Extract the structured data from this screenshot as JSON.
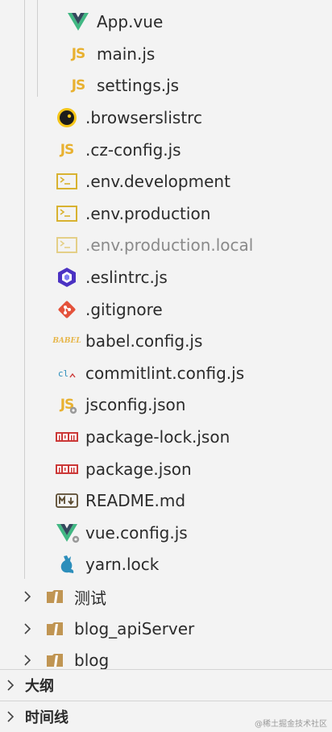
{
  "files": [
    {
      "label": "App.vue",
      "icon": "vue-icon",
      "dim": false
    },
    {
      "label": "main.js",
      "icon": "js-icon",
      "dim": false
    },
    {
      "label": "settings.js",
      "icon": "js-icon",
      "dim": false
    },
    {
      "label": ".browserslistrc",
      "icon": "browserslist-icon",
      "dim": false
    },
    {
      "label": ".cz-config.js",
      "icon": "js-icon",
      "dim": false
    },
    {
      "label": ".env.development",
      "icon": "env-terminal-icon",
      "dim": false
    },
    {
      "label": ".env.production",
      "icon": "env-terminal-icon",
      "dim": false
    },
    {
      "label": ".env.production.local",
      "icon": "env-terminal-icon",
      "dim": true
    },
    {
      "label": ".eslintrc.js",
      "icon": "eslint-icon",
      "dim": false
    },
    {
      "label": ".gitignore",
      "icon": "git-icon",
      "dim": false
    },
    {
      "label": "babel.config.js",
      "icon": "babel-icon",
      "dim": false
    },
    {
      "label": "commitlint.config.js",
      "icon": "commitlint-icon",
      "dim": false
    },
    {
      "label": "jsconfig.json",
      "icon": "jsconfig-icon",
      "dim": false
    },
    {
      "label": "package-lock.json",
      "icon": "npm-icon",
      "dim": false
    },
    {
      "label": "package.json",
      "icon": "npm-icon",
      "dim": false
    },
    {
      "label": "README.md",
      "icon": "markdown-icon",
      "dim": false
    },
    {
      "label": "vue.config.js",
      "icon": "vue-config-icon",
      "dim": false
    },
    {
      "label": "yarn.lock",
      "icon": "yarn-icon",
      "dim": false
    }
  ],
  "folders": [
    {
      "label": "测试",
      "icon": "folder-icon"
    },
    {
      "label": "blog_apiServer",
      "icon": "folder-icon"
    },
    {
      "label": "blog",
      "icon": "folder-icon"
    }
  ],
  "sections": [
    {
      "label": "大纲",
      "icon": "chevron-right-icon"
    },
    {
      "label": "时间线",
      "icon": "chevron-right-icon"
    }
  ],
  "glyphs": {
    "js": "JS",
    "babel": "BABEL",
    "commitlint": "cl"
  },
  "watermark": "@稀土掘金技术社区",
  "colors": {
    "vue_green": "#41b883",
    "vue_dark": "#35495e",
    "js_yellow": "#e8b130",
    "git_orange": "#e4523b",
    "eslint_purple": "#4b32c3",
    "npm_red": "#cb3837",
    "yarn_blue": "#2c8ebb",
    "folder_tan": "#c09553"
  }
}
